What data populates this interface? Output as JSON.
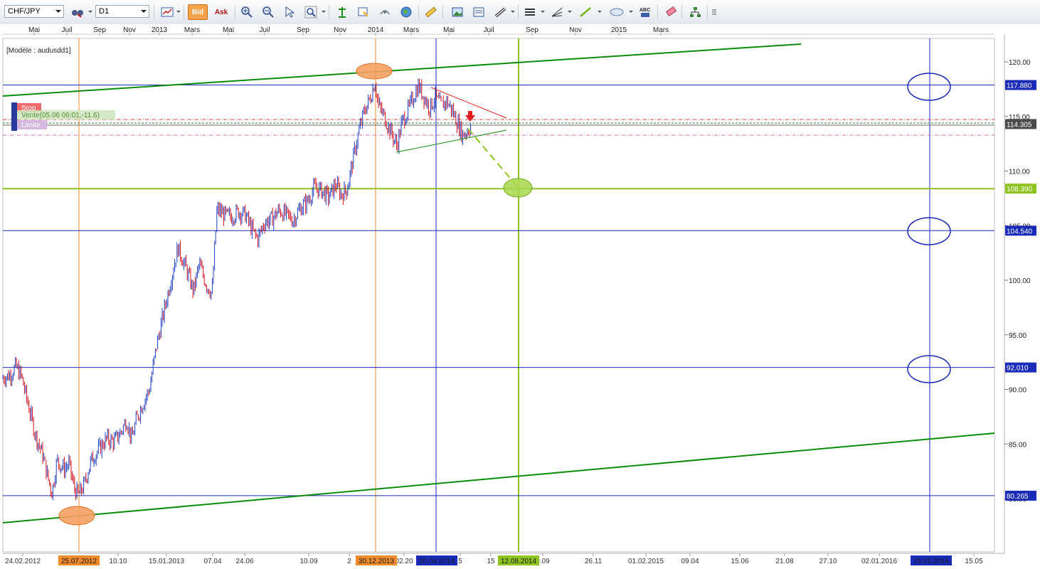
{
  "toolbar": {
    "symbol": "CHF/JPY",
    "timeframe": "D1",
    "bid_label": "Bid",
    "ask_label": "Ask",
    "icons": [
      "chart-type-icon",
      "bid-icon",
      "ask-icon",
      "zoom-in-icon",
      "zoom-out-icon",
      "cursor-icon",
      "magnifier-icon",
      "indicator-icon",
      "template-icon",
      "studies-icon",
      "globe-icon",
      "ruler-icon",
      "image-icon",
      "snapshot-icon",
      "drawing-icon",
      "lines-icon",
      "fibonacci-icon",
      "trendline-icon",
      "ellipse-icon",
      "text-abc-icon",
      "eraser-icon",
      "hierarchy-icon"
    ]
  },
  "chart": {
    "model_label": "[Modèle : audusdd1]",
    "order_stop_label": "Stop",
    "order_vente_label": "Vente(05.06 06:01,-11.6)",
    "order_limite_label": "Limite",
    "colors": {
      "bull": "#1f3fbf",
      "bear": "#d01020",
      "green_trend": "#0a8c0a",
      "lime": "#8ec21f",
      "orange": "#f08a2a",
      "blue": "#1a2bb8",
      "red_line": "#e02020"
    }
  },
  "chart_data": {
    "type": "candlestick",
    "symbol": "CHF/JPY",
    "timeframe": "D1",
    "top_axis_labels": [
      "Mai",
      "Juil",
      "Sep",
      "Nov",
      "2013",
      "Mars",
      "Mai",
      "Juil",
      "Sep",
      "Nov",
      "2014",
      "Mars",
      "Mai",
      "Juil",
      "Sep",
      "Nov",
      "2015",
      "Mars"
    ],
    "bottom_axis_labels": [
      "24.02.2012",
      "10.10",
      "15.01.2013",
      "07.04",
      "24.06",
      "10.09",
      "2",
      "02.20",
      "5",
      "15",
      "0.09",
      "26.11",
      "01.02.2015",
      "09.04",
      "15.06",
      "21.08",
      "27.10",
      "02.01.2016",
      "15.05"
    ],
    "highlighted_dates": [
      {
        "label": "25.07.2012",
        "color": "#f08a2a"
      },
      {
        "label": "30.12.2013",
        "color": "#f08a2a"
      },
      {
        "label": "10.04.2014",
        "color": "#1a2bb8"
      },
      {
        "label": "12.08.2014",
        "color": "#8ec21f"
      },
      {
        "label": "15.03.2016",
        "color": "#1a2bb8"
      }
    ],
    "y_ticks": [
      "120.00",
      "115.00",
      "110.00",
      "105.00",
      "100.00",
      "95.00",
      "90.00",
      "85.00",
      "80.00"
    ],
    "ylim": [
      76.5,
      121.5
    ],
    "price_tags": [
      {
        "label": "117.880",
        "value": 117.88,
        "color": "#1a2bb8"
      },
      {
        "label": "114.305",
        "value": 114.305,
        "color": "#4a4a4a"
      },
      {
        "label": "108.390",
        "value": 108.39,
        "color": "#8ec21f"
      },
      {
        "label": "104.540",
        "value": 104.54,
        "color": "#1a2bb8"
      },
      {
        "label": "92.010",
        "value": 92.01,
        "color": "#1a2bb8"
      },
      {
        "label": "80.265",
        "value": 80.265,
        "color": "#1a2bb8"
      }
    ],
    "price_path": [
      [
        0,
        91
      ],
      [
        14,
        91.3
      ],
      [
        22,
        92.1
      ],
      [
        30,
        91.2
      ],
      [
        40,
        88.5
      ],
      [
        50,
        85.8
      ],
      [
        60,
        84
      ],
      [
        67,
        82
      ],
      [
        73,
        80.5
      ],
      [
        80,
        83.5
      ],
      [
        90,
        82.7
      ],
      [
        97,
        83.2
      ],
      [
        104,
        81
      ],
      [
        110,
        80.3
      ],
      [
        118,
        81.2
      ],
      [
        128,
        83.5
      ],
      [
        140,
        84.6
      ],
      [
        150,
        85.5
      ],
      [
        160,
        85.2
      ],
      [
        170,
        86.1
      ],
      [
        178,
        87.2
      ],
      [
        185,
        85.4
      ],
      [
        192,
        87.3
      ],
      [
        200,
        88.6
      ],
      [
        210,
        90
      ],
      [
        220,
        94
      ],
      [
        230,
        97
      ],
      [
        240,
        100
      ],
      [
        250,
        103
      ],
      [
        262,
        101
      ],
      [
        272,
        99
      ],
      [
        280,
        101.5
      ],
      [
        290,
        99.6
      ],
      [
        298,
        98.8
      ],
      [
        305,
        106.5
      ],
      [
        315,
        106
      ],
      [
        325,
        105.8
      ],
      [
        335,
        106.3
      ],
      [
        345,
        106
      ],
      [
        355,
        104.5
      ],
      [
        362,
        103.8
      ],
      [
        372,
        105.3
      ],
      [
        382,
        105.6
      ],
      [
        392,
        106.4
      ],
      [
        402,
        106
      ],
      [
        412,
        105.5
      ],
      [
        422,
        106.6
      ],
      [
        432,
        107.2
      ],
      [
        442,
        108.5
      ],
      [
        452,
        108.2
      ],
      [
        462,
        107.6
      ],
      [
        472,
        108.8
      ],
      [
        480,
        107.8
      ],
      [
        488,
        108.4
      ],
      [
        496,
        111
      ],
      [
        504,
        113.5
      ],
      [
        512,
        115.5
      ],
      [
        520,
        116.6
      ],
      [
        527,
        118.2
      ],
      [
        532,
        116
      ],
      [
        540,
        115
      ],
      [
        550,
        113.5
      ],
      [
        558,
        112.3
      ],
      [
        565,
        114.5
      ],
      [
        572,
        115.3
      ],
      [
        580,
        116.6
      ],
      [
        588,
        117.8
      ],
      [
        596,
        116.8
      ],
      [
        604,
        115.8
      ],
      [
        612,
        116.7
      ],
      [
        620,
        116
      ],
      [
        628,
        116.4
      ],
      [
        636,
        115.5
      ],
      [
        644,
        114.3
      ],
      [
        650,
        113.3
      ],
      [
        657,
        113.7
      ],
      [
        662,
        114.1
      ]
    ],
    "horizontal_lines": [
      117.88,
      108.39,
      104.54,
      92.01,
      80.265
    ],
    "vertical_line_dates": [
      "25.07.2012",
      "30.12.2013",
      "10.04.2014",
      "12.08.2014",
      "15.03.2016"
    ]
  }
}
